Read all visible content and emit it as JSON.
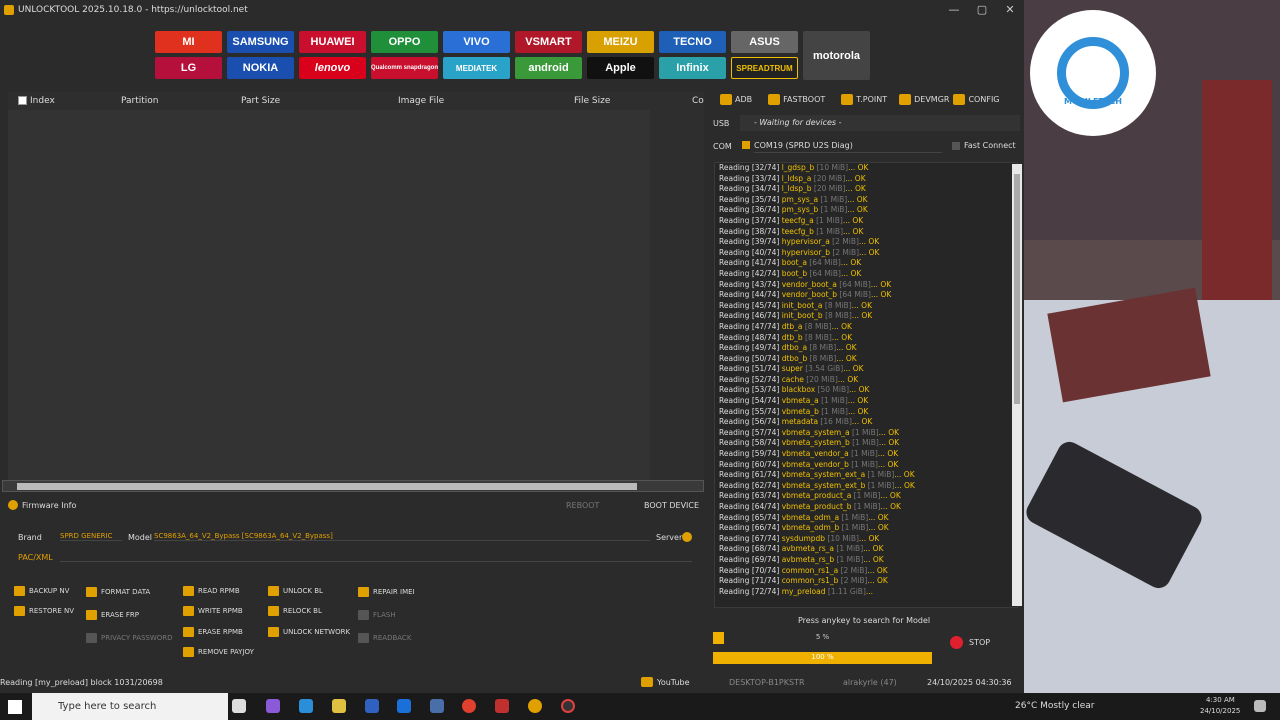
{
  "titlebar": {
    "title": "UNLOCKTOOL 2025.10.18.0 - https://unlocktool.net",
    "min": "—",
    "max": "▢",
    "close": "✕"
  },
  "brands": [
    "MI",
    "SAMSUNG",
    "HUAWEI",
    "OPPO",
    "VIVO",
    "VSMART",
    "MEIZU",
    "TECNO",
    "ASUS",
    "motorola",
    "LG",
    "NOKIA",
    "lenovo",
    "Qualcomm snapdragon",
    "MEDIATEK",
    "android",
    "Apple",
    "Infinix",
    "SPREADTRUM"
  ],
  "grid": {
    "headers": [
      "Index",
      "Partition",
      "Part Size",
      "Image File",
      "File Size",
      "Co"
    ]
  },
  "firmware": {
    "label": "Firmware Info",
    "reboot": "REBOOT",
    "boot_device": "BOOT DEVICE"
  },
  "brandrow": {
    "brand_label": "Brand",
    "brand_value": "SPRD GENERIC",
    "model_label": "Model",
    "model_value": "SC9863A_64_V2_Bypass [SC9863A_64_V2_Bypass]",
    "server_label": "Server"
  },
  "pac_label": "PAC/XML",
  "actions": {
    "backup_nv": "BACKUP NV",
    "restore_nv": "RESTORE NV",
    "format_data": "FORMAT DATA",
    "erase_frp": "ERASE FRP",
    "privacy_password": "PRIVACY PASSWORD",
    "read_rpmb": "READ RPMB",
    "write_rpmb": "WRITE RPMB",
    "erase_rpmb": "ERASE RPMB",
    "remove_payjoy": "REMOVE PAYJOY",
    "unlock_bl": "UNLOCK BL",
    "relock_bl": "RELOCK BL",
    "unlock_network": "UNLOCK NETWORK",
    "repair_imei": "REPAIR IMEI",
    "flash": "FLASH",
    "readback": "READBACK"
  },
  "tabs": {
    "adb": "ADB",
    "fastboot": "FASTBOOT",
    "tpoint": "T.POINT",
    "devmgr": "DEVMGR",
    "config": "CONFIG"
  },
  "usb": {
    "label": "USB",
    "value": "- Waiting for devices -"
  },
  "com": {
    "label": "COM",
    "value": "COM19 (SPRD U2S Diag)",
    "fast_connect": "Fast Connect"
  },
  "log": [
    [
      "Reading [32/74] ",
      "l_gdsp_b",
      " [10 MiB]",
      "... OK"
    ],
    [
      "Reading [33/74] ",
      "l_ldsp_a",
      " [20 MiB]",
      "... OK"
    ],
    [
      "Reading [34/74] ",
      "l_ldsp_b",
      " [20 MiB]",
      "... OK"
    ],
    [
      "Reading [35/74] ",
      "pm_sys_a",
      " [1 MiB]",
      "... OK"
    ],
    [
      "Reading [36/74] ",
      "pm_sys_b",
      " [1 MiB]",
      "... OK"
    ],
    [
      "Reading [37/74] ",
      "teecfg_a",
      " [1 MiB]",
      "... OK"
    ],
    [
      "Reading [38/74] ",
      "teecfg_b",
      " [1 MiB]",
      "... OK"
    ],
    [
      "Reading [39/74] ",
      "hypervisor_a",
      " [2 MiB]",
      "... OK"
    ],
    [
      "Reading [40/74] ",
      "hypervisor_b",
      " [2 MiB]",
      "... OK"
    ],
    [
      "Reading [41/74] ",
      "boot_a",
      " [64 MiB]",
      "... OK"
    ],
    [
      "Reading [42/74] ",
      "boot_b",
      " [64 MiB]",
      "... OK"
    ],
    [
      "Reading [43/74] ",
      "vendor_boot_a",
      " [64 MiB]",
      "... OK"
    ],
    [
      "Reading [44/74] ",
      "vendor_boot_b",
      " [64 MiB]",
      "... OK"
    ],
    [
      "Reading [45/74] ",
      "init_boot_a",
      " [8 MiB]",
      "... OK"
    ],
    [
      "Reading [46/74] ",
      "init_boot_b",
      " [8 MiB]",
      "... OK"
    ],
    [
      "Reading [47/74] ",
      "dtb_a",
      " [8 MiB]",
      "... OK"
    ],
    [
      "Reading [48/74] ",
      "dtb_b",
      " [8 MiB]",
      "... OK"
    ],
    [
      "Reading [49/74] ",
      "dtbo_a",
      " [8 MiB]",
      "... OK"
    ],
    [
      "Reading [50/74] ",
      "dtbo_b",
      " [8 MiB]",
      "... OK"
    ],
    [
      "Reading [51/74] ",
      "super",
      " [3.54 GiB]",
      "... OK"
    ],
    [
      "Reading [52/74] ",
      "cache",
      " [20 MiB]",
      "... OK"
    ],
    [
      "Reading [53/74] ",
      "blackbox",
      " [50 MiB]",
      "... OK"
    ],
    [
      "Reading [54/74] ",
      "vbmeta_a",
      " [1 MiB]",
      "... OK"
    ],
    [
      "Reading [55/74] ",
      "vbmeta_b",
      " [1 MiB]",
      "... OK"
    ],
    [
      "Reading [56/74] ",
      "metadata",
      " [16 MiB]",
      "... OK"
    ],
    [
      "Reading [57/74] ",
      "vbmeta_system_a",
      " [1 MiB]",
      "... OK"
    ],
    [
      "Reading [58/74] ",
      "vbmeta_system_b",
      " [1 MiB]",
      "... OK"
    ],
    [
      "Reading [59/74] ",
      "vbmeta_vendor_a",
      " [1 MiB]",
      "... OK"
    ],
    [
      "Reading [60/74] ",
      "vbmeta_vendor_b",
      " [1 MiB]",
      "... OK"
    ],
    [
      "Reading [61/74] ",
      "vbmeta_system_ext_a",
      " [1 MiB]",
      "... OK"
    ],
    [
      "Reading [62/74] ",
      "vbmeta_system_ext_b",
      " [1 MiB]",
      "... OK"
    ],
    [
      "Reading [63/74] ",
      "vbmeta_product_a",
      " [1 MiB]",
      "... OK"
    ],
    [
      "Reading [64/74] ",
      "vbmeta_product_b",
      " [1 MiB]",
      "... OK"
    ],
    [
      "Reading [65/74] ",
      "vbmeta_odm_a",
      " [1 MiB]",
      "... OK"
    ],
    [
      "Reading [66/74] ",
      "vbmeta_odm_b",
      " [1 MiB]",
      "... OK"
    ],
    [
      "Reading [67/74] ",
      "sysdumpdb",
      " [10 MiB]",
      "... OK"
    ],
    [
      "Reading [68/74] ",
      "avbmeta_rs_a",
      " [1 MiB]",
      "... OK"
    ],
    [
      "Reading [69/74] ",
      "avbmeta_rs_b",
      " [1 MiB]",
      "... OK"
    ],
    [
      "Reading [70/74] ",
      "common_rs1_a",
      " [2 MiB]",
      "... OK"
    ],
    [
      "Reading [71/74] ",
      "common_rs1_b",
      " [2 MiB]",
      "... OK"
    ],
    [
      "Reading [72/74] ",
      "my_preload",
      " [1.11 GiB]",
      "..."
    ]
  ],
  "search_hint": "Press anykey to search for Model",
  "progress1": {
    "label": "5 %",
    "fraction": 0.05
  },
  "progress2": {
    "label": "100 %",
    "fraction": 1.0
  },
  "stop": "STOP",
  "status": {
    "left": "Reading [my_preload] block 1031/20698",
    "youtube": "YouTube",
    "pc": "DESKTOP-B1PKSTR",
    "user": "alrakyrle (47)",
    "datetime": "24/10/2025 04:30:36"
  },
  "taskbar": {
    "search": "Type here to search",
    "weather": "26°C  Mostly clear",
    "time": "4:30 AM",
    "date": "24/10/2025"
  },
  "camera": {
    "overlay_text": "MOBILETECH"
  },
  "colors": {
    "accent": "#e0a000",
    "ok": "#f0c000"
  }
}
